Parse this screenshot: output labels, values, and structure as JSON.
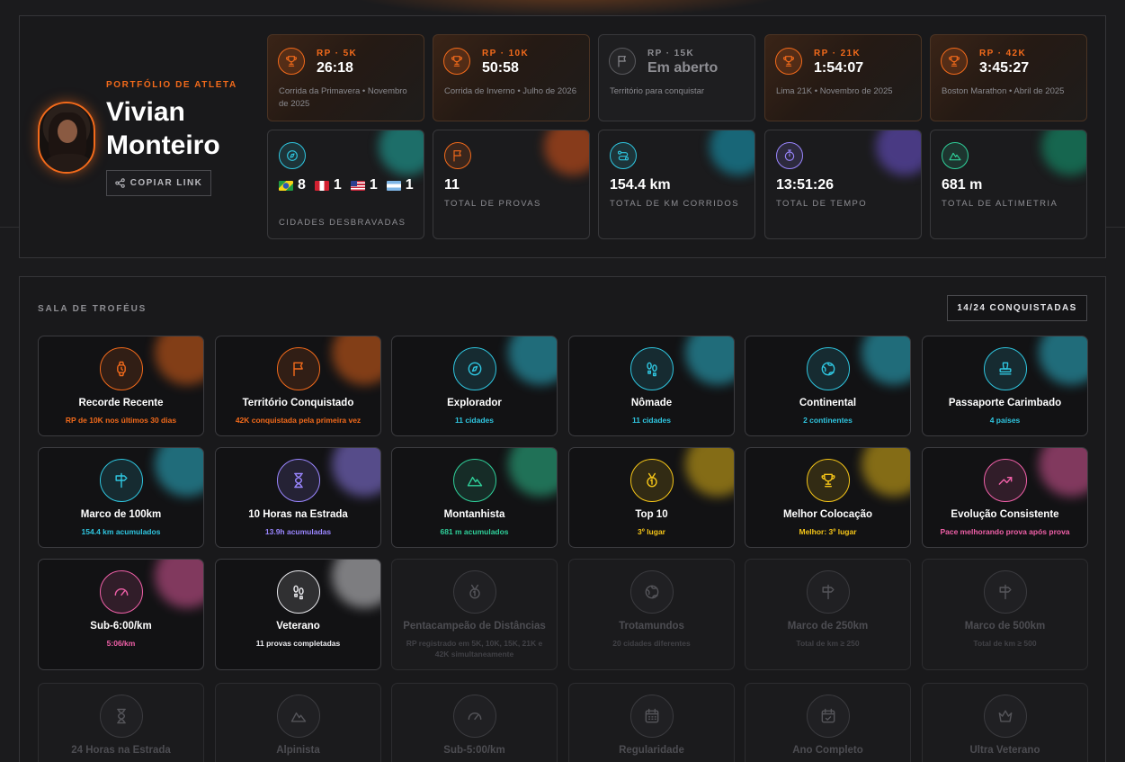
{
  "profile": {
    "kicker": "PORTFÓLIO DE ATLETA",
    "name": "Vivian Monteiro",
    "copy_link": "COPIAR LINK"
  },
  "records": [
    {
      "label": "RP · 5K",
      "time": "26:18",
      "desc": "Corrida da Primavera • Novembro de 2025",
      "open": false
    },
    {
      "label": "RP · 10K",
      "time": "50:58",
      "desc": "Corrida de Inverno • Julho de 2026",
      "open": false
    },
    {
      "label": "RP · 15K",
      "time": "Em aberto",
      "desc": "Território para conquistar",
      "open": true
    },
    {
      "label": "RP · 21K",
      "time": "1:54:07",
      "desc": "Lima 21K • Novembro de 2025",
      "open": false
    },
    {
      "label": "RP · 42K",
      "time": "3:45:27",
      "desc": "Boston Marathon • Abril de 2025",
      "open": false
    }
  ],
  "stats": {
    "cities": {
      "label": "CIDADES DESBRAVADAS",
      "countries": [
        {
          "flag": "br",
          "count": "8"
        },
        {
          "flag": "pe",
          "count": "1"
        },
        {
          "flag": "us",
          "count": "1"
        },
        {
          "flag": "ar",
          "count": "1"
        }
      ],
      "color": "#2fc6e0",
      "glow": "#1fb3a8"
    },
    "items": [
      {
        "value": "11",
        "label": "TOTAL DE PROVAS",
        "icon": "flag-icon",
        "color": "#f26a1b",
        "glow": "#e0561a"
      },
      {
        "value": "154.4 km",
        "label": "TOTAL DE KM CORRIDOS",
        "icon": "route-icon",
        "color": "#2fc6e0",
        "glow": "#16a5c2"
      },
      {
        "value": "13:51:26",
        "label": "TOTAL DE TEMPO",
        "icon": "stopwatch-icon",
        "color": "#9a86ff",
        "glow": "#6f55d8"
      },
      {
        "value": "681 m",
        "label": "TOTAL DE ALTIMETRIA",
        "icon": "mountain-icon",
        "color": "#2fd09a",
        "glow": "#13a478"
      }
    ]
  },
  "trophies_section": {
    "title": "SALA DE TROFÉUS",
    "count": "14/24 CONQUISTADAS"
  },
  "trophies": [
    {
      "name": "Recorde Recente",
      "desc": "RP de 10K nos últimos 30 dias",
      "icon": "watch-icon",
      "color": "#f26a1b",
      "locked": false
    },
    {
      "name": "Território Conquistado",
      "desc": "42K conquistada pela primeira vez",
      "icon": "flag-icon",
      "color": "#f26a1b",
      "locked": false
    },
    {
      "name": "Explorador",
      "desc": "11 cidades",
      "icon": "compass-icon",
      "color": "#2fc6e0",
      "locked": false
    },
    {
      "name": "Nômade",
      "desc": "11 cidades",
      "icon": "footprints-icon",
      "color": "#2fc6e0",
      "locked": false
    },
    {
      "name": "Continental",
      "desc": "2 continentes",
      "icon": "globe-icon",
      "color": "#2fc6e0",
      "locked": false
    },
    {
      "name": "Passaporte Carimbado",
      "desc": "4 países",
      "icon": "stamp-icon",
      "color": "#2fc6e0",
      "locked": false
    },
    {
      "name": "Marco de 100km",
      "desc": "154.4 km acumulados",
      "icon": "signpost-icon",
      "color": "#2fc6e0",
      "locked": false
    },
    {
      "name": "10 Horas na Estrada",
      "desc": "13.9h acumuladas",
      "icon": "hourglass-icon",
      "color": "#9a86ff",
      "locked": false
    },
    {
      "name": "Montanhista",
      "desc": "681 m acumulados",
      "icon": "mountain-icon",
      "color": "#2fd09a",
      "locked": false
    },
    {
      "name": "Top 10",
      "desc": "3º lugar",
      "icon": "medal-icon",
      "color": "#f5c518",
      "locked": false
    },
    {
      "name": "Melhor Colocação",
      "desc": "Melhor: 3º lugar",
      "icon": "trophy-icon",
      "color": "#f5c518",
      "locked": false
    },
    {
      "name": "Evolução Consistente",
      "desc": "Pace melhorando prova após prova",
      "icon": "trending-up-icon",
      "color": "#f060a8",
      "locked": false
    },
    {
      "name": "Sub-6:00/km",
      "desc": "5:06/km",
      "icon": "gauge-icon",
      "color": "#f060a8",
      "locked": false
    },
    {
      "name": "Veterano",
      "desc": "11 provas completadas",
      "icon": "footprints-icon",
      "color": "#e8e8ec",
      "locked": false
    },
    {
      "name": "Pentacampeão de Distâncias",
      "desc": "RP registrado em 5K, 10K, 15K, 21K e 42K simultaneamente",
      "icon": "medal-icon",
      "color": "#55555a",
      "locked": true
    },
    {
      "name": "Trotamundos",
      "desc": "20 cidades diferentes",
      "icon": "globe-icon",
      "color": "#55555a",
      "locked": true
    },
    {
      "name": "Marco de 250km",
      "desc": "Total de km ≥ 250",
      "icon": "signpost-icon",
      "color": "#55555a",
      "locked": true
    },
    {
      "name": "Marco de 500km",
      "desc": "Total de km ≥ 500",
      "icon": "signpost-icon",
      "color": "#55555a",
      "locked": true
    },
    {
      "name": "24 Horas na Estrada",
      "desc": "",
      "icon": "hourglass-icon",
      "color": "#55555a",
      "locked": true
    },
    {
      "name": "Alpinista",
      "desc": "",
      "icon": "mountain-icon",
      "color": "#55555a",
      "locked": true
    },
    {
      "name": "Sub-5:00/km",
      "desc": "",
      "icon": "gauge-icon",
      "color": "#55555a",
      "locked": true
    },
    {
      "name": "Regularidade",
      "desc": "",
      "icon": "calendar-icon",
      "color": "#55555a",
      "locked": true
    },
    {
      "name": "Ano Completo",
      "desc": "",
      "icon": "calendar-check-icon",
      "color": "#55555a",
      "locked": true
    },
    {
      "name": "Ultra Veterano",
      "desc": "",
      "icon": "crown-icon",
      "color": "#55555a",
      "locked": true
    }
  ]
}
